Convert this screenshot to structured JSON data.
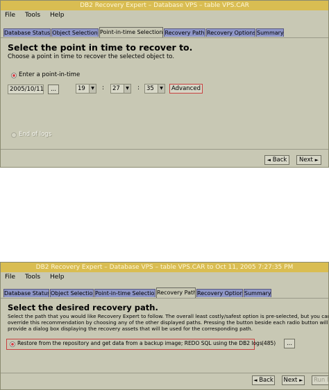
{
  "window1": {
    "title": "DB2 Recovery Expert – Database VPS – table VPS.CAR",
    "menu": [
      "File",
      "Tools",
      "Help"
    ],
    "tabs": [
      "Database Status",
      "Object Selection",
      "Point-in-time Selection",
      "Recovery Path",
      "Recovery Options",
      "Summary"
    ],
    "active_tab": 2,
    "heading": "Select the point in time to recover to.",
    "subheading": "Choose a point in time to recover the selected object to.",
    "radio_point": "Enter a point-in-time",
    "date": "2005/10/11",
    "ellipsis": "...",
    "hour": "19",
    "minute": "27",
    "second": "35",
    "colon": ":",
    "advanced": "Advanced",
    "radio_end": "End of logs",
    "back": "Back",
    "next": "Next",
    "dropdown_glyph": "▼",
    "back_glyph": "◄",
    "next_glyph": "►"
  },
  "window2": {
    "title": "DB2 Recovery Expert – Database VPS – table VPS.CAR to Oct 11, 2005 7:27:35 PM",
    "menu": [
      "File",
      "Tools",
      "Help"
    ],
    "tabs": [
      "Database Status",
      "Object Selection",
      "Point-in-time Selection",
      "Recovery Path",
      "Recovery Options",
      "Summary"
    ],
    "active_tab": 3,
    "heading": "Select the desired recovery path.",
    "desc1": "Select the path that you would like Recovery Expert to follow. The overall least costly/safest option is pre-selected, but you can",
    "desc2": "override this recommendation by choosing any of the other displayed paths. Pressing the button beside each radio button will",
    "desc3": "provide a dialog box displaying the recovery assets that will be used for the corresponding path.",
    "path_option": "Restore from the repository and get data from a backup image; REDO SQL using the DB2 logs",
    "path_cost": "(485)",
    "ellipsis": "...",
    "back": "Back",
    "next": "Next",
    "run": "Run N",
    "back_glyph": "◄",
    "next_glyph": "►"
  }
}
